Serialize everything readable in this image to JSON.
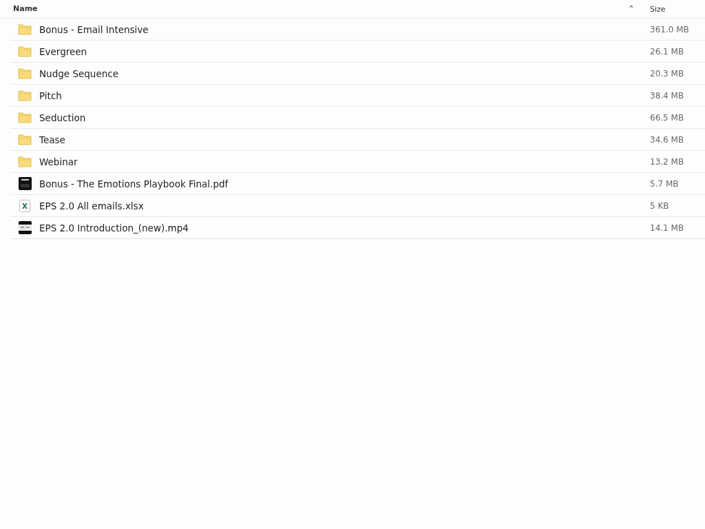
{
  "columns": [
    {
      "label": "Name",
      "sorted": true
    },
    {
      "label": "Size",
      "sorted": false
    }
  ],
  "sort_indicator": "⌃",
  "files": [
    {
      "kind": "folder",
      "name": "Bonus - Email Intensive",
      "size": "361.0 MB"
    },
    {
      "kind": "folder",
      "name": "Evergreen",
      "size": "26.1 MB"
    },
    {
      "kind": "folder",
      "name": "Nudge Sequence",
      "size": "20.3 MB"
    },
    {
      "kind": "folder",
      "name": "Pitch",
      "size": "38.4 MB"
    },
    {
      "kind": "folder",
      "name": "Seduction",
      "size": "66.5 MB"
    },
    {
      "kind": "folder",
      "name": "Tease",
      "size": "34.6 MB"
    },
    {
      "kind": "folder",
      "name": "Webinar",
      "size": "13.2 MB"
    },
    {
      "kind": "pdf",
      "name": "Bonus - The Emotions Playbook Final.pdf",
      "size": "5.7 MB"
    },
    {
      "kind": "spreadsheet",
      "name": "EPS 2.0 All emails.xlsx",
      "size": "5 KB"
    },
    {
      "kind": "video",
      "name": "EPS 2.0 Introduction_(new).mp4",
      "size": "14.1 MB"
    }
  ]
}
